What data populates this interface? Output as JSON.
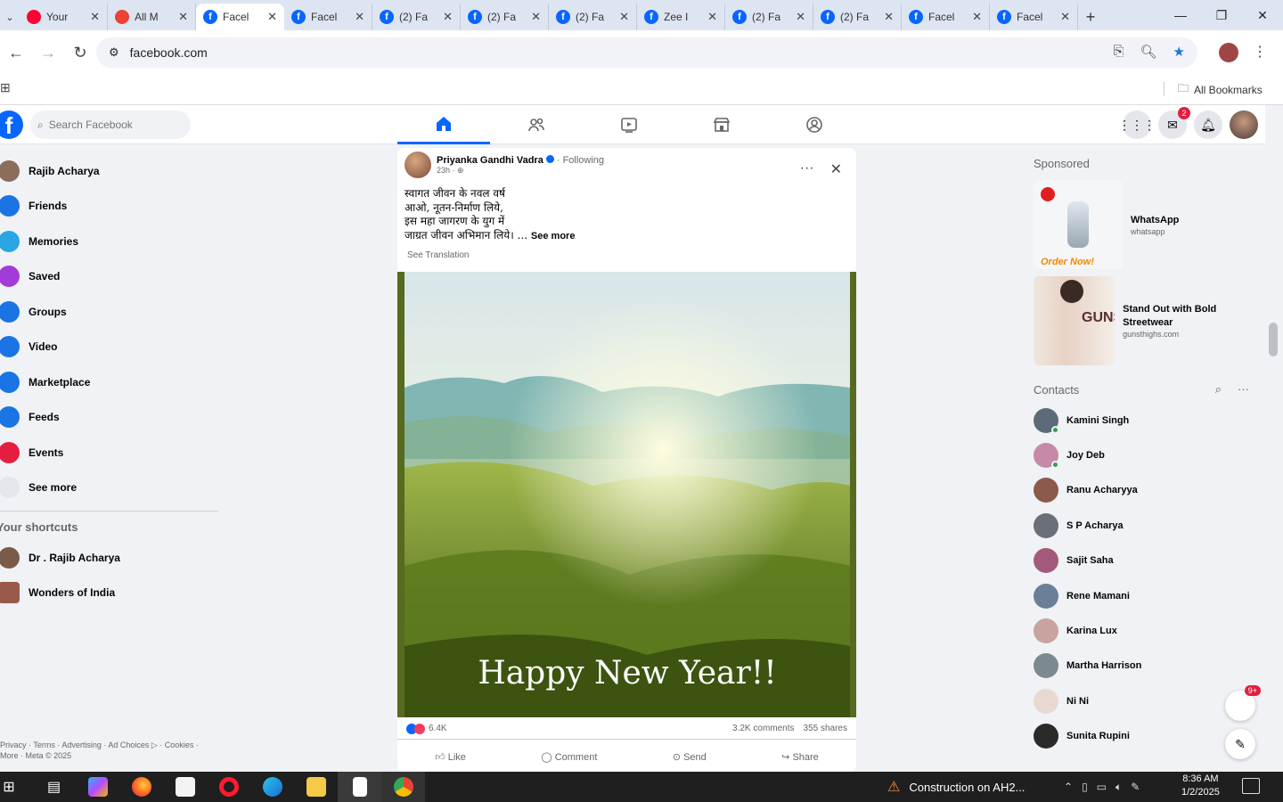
{
  "browser": {
    "tabs": [
      {
        "label": "Your",
        "icon": "youtube-icon",
        "color": "#ff0033"
      },
      {
        "label": "All M",
        "icon": "gmail-icon",
        "color": "#ea4335"
      },
      {
        "label": "Facel",
        "icon": "facebook-icon",
        "color": "#0866ff",
        "active": true
      },
      {
        "label": "Facel",
        "icon": "facebook-icon",
        "color": "#0866ff"
      },
      {
        "label": "(2) Fa",
        "icon": "facebook-icon",
        "color": "#0866ff"
      },
      {
        "label": "(2) Fa",
        "icon": "facebook-icon",
        "color": "#0866ff"
      },
      {
        "label": "(2) Fa",
        "icon": "facebook-icon",
        "color": "#0866ff"
      },
      {
        "label": "Zee I",
        "icon": "facebook-icon",
        "color": "#0866ff"
      },
      {
        "label": "(2) Fa",
        "icon": "facebook-icon",
        "color": "#0866ff"
      },
      {
        "label": "(2) Fa",
        "icon": "facebook-icon",
        "color": "#0866ff"
      },
      {
        "label": "Facel",
        "icon": "facebook-icon",
        "color": "#0866ff"
      },
      {
        "label": "Facel",
        "icon": "facebook-icon",
        "color": "#0866ff"
      }
    ],
    "url": "facebook.com",
    "all_bookmarks": "All Bookmarks"
  },
  "fb": {
    "search_placeholder": "Search Facebook",
    "messenger_badge": "2",
    "left_nav": [
      {
        "label": "Rajib Acharya",
        "icon": "profile-avatar",
        "color": "#8a6d5a"
      },
      {
        "label": "Friends",
        "icon": "friends-icon",
        "color": "#1b74e4"
      },
      {
        "label": "Memories",
        "icon": "memories-icon",
        "color": "#2aa6e5"
      },
      {
        "label": "Saved",
        "icon": "saved-icon",
        "color": "#a33bdb"
      },
      {
        "label": "Groups",
        "icon": "groups-icon",
        "color": "#1b74e4"
      },
      {
        "label": "Video",
        "icon": "video-icon",
        "color": "#1b74e4"
      },
      {
        "label": "Marketplace",
        "icon": "marketplace-icon",
        "color": "#1b74e4"
      },
      {
        "label": "Feeds",
        "icon": "feeds-icon",
        "color": "#1b74e4"
      },
      {
        "label": "Events",
        "icon": "events-icon",
        "color": "#e41e3f"
      },
      {
        "label": "See more",
        "icon": "chevron-down-icon",
        "color": "#e4e6eb"
      }
    ],
    "shortcuts_title": "Your shortcuts",
    "shortcuts": [
      {
        "label": "Dr . Rajib Acharya",
        "color": "#7a5b48"
      },
      {
        "label": "Wonders of India",
        "color": "#9a5a4a"
      }
    ],
    "footer_line1": "Privacy · Terms · Advertising · Ad Choices ▷ · Cookies ·",
    "footer_line2": "More · Meta © 2025",
    "post": {
      "author": "Priyanka Gandhi Vadra",
      "following": "· Following",
      "time": "23h · ",
      "lines": [
        "स्वागत जीवन के नवल वर्ष",
        "आओ, नूतन-निर्माण लिये,",
        "इस महा जागरण के युग में",
        "जाग्रत जीवन अभिमान लिये। ..."
      ],
      "see_more": "See more",
      "see_translation": "See Translation",
      "image_caption": "Happy New Year!!",
      "reactions_count": "6.4K",
      "comments": "3.2K comments",
      "shares": "355 shares",
      "actions": [
        "Like",
        "Comment",
        "Send",
        "Share"
      ]
    },
    "sponsored_title": "Sponsored",
    "ads": [
      {
        "title": "WhatsApp",
        "url": "whatsapp",
        "image_text": "Order Now!"
      },
      {
        "title": "Stand Out with Bold Streetwear",
        "url": "gunsthighs.com",
        "image_text": "GUNS"
      }
    ],
    "contacts_title": "Contacts",
    "contacts": [
      {
        "name": "Kamini Singh",
        "color": "#5b6b7a",
        "online": true
      },
      {
        "name": "Joy Deb",
        "color": "#c58aa8",
        "online": true
      },
      {
        "name": "Ranu Acharyya",
        "color": "#8c5a4a",
        "online": false
      },
      {
        "name": "S P Acharya",
        "color": "#6a6f78",
        "online": false
      },
      {
        "name": "Sajit Saha",
        "color": "#a35a7a",
        "online": false
      },
      {
        "name": "Rene Mamani",
        "color": "#6a8099",
        "online": false
      },
      {
        "name": "Karina Lux",
        "color": "#c9a3a0",
        "online": false
      },
      {
        "name": "Martha Harrison",
        "color": "#7c8a90",
        "online": false
      },
      {
        "name": "Ni Ni",
        "color": "#e8d8cf",
        "online": false
      },
      {
        "name": "Sunita Rupini",
        "color": "#2a2a2a",
        "online": false
      }
    ],
    "chat_badge": "9+"
  },
  "taskbar": {
    "notification": "Construction on AH2...",
    "time": "8:36 AM",
    "date": "1/2/2025"
  }
}
